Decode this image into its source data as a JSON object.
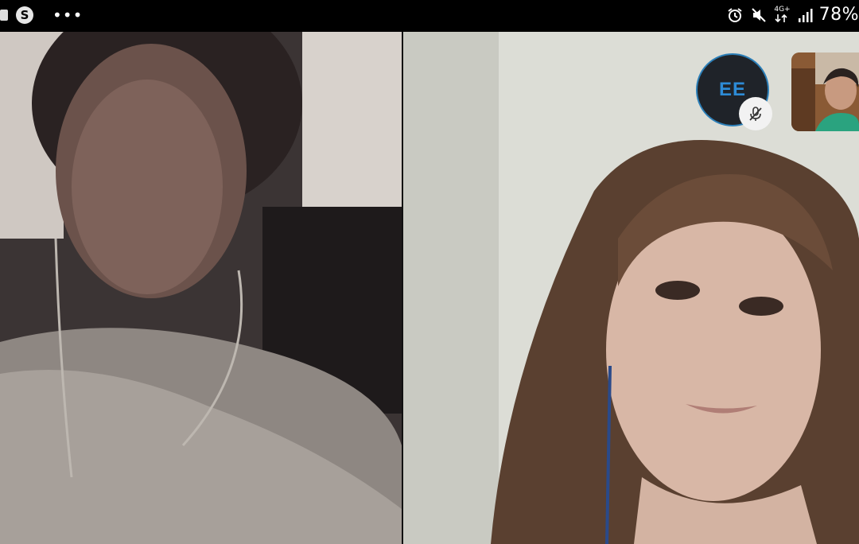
{
  "status_bar": {
    "left_icons": [
      "notification-icon",
      "skype-icon",
      "more-icon"
    ],
    "skype_glyph": "S",
    "more_glyph": "•••",
    "right_icons": [
      "alarm-icon",
      "mute-icon",
      "network-4g-icon",
      "signal-icon"
    ],
    "network_label": "4G+",
    "battery": "78%"
  },
  "call": {
    "participant": {
      "initials": "EE",
      "muted": true,
      "ring_color": "#2c7fb8",
      "initials_color": "#2d8bd6"
    }
  }
}
